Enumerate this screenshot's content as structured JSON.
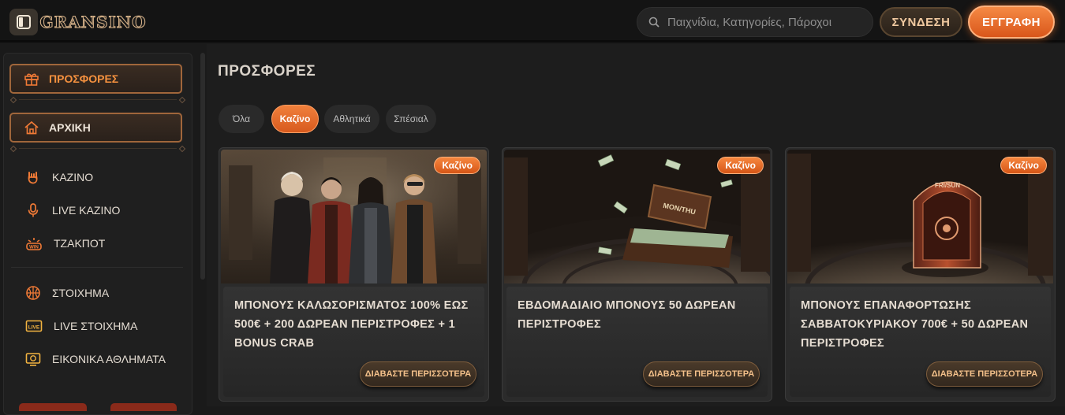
{
  "header": {
    "logo_text": "GRANSINO",
    "search_placeholder": "Παιχνίδια, Κατηγορίες, Πάροχοι",
    "login_label": "ΣΥΝΔΕΣΗ",
    "register_label": "ΕΓΓΡΑΦΗ"
  },
  "sidebar": {
    "promotions_label": "ΠΡΟΣΦΟΡΕΣ",
    "home_label": "ΑΡΧΙΚΗ",
    "casino_items": [
      {
        "label": "ΚΑΖΙΝΟ",
        "icon": "rock-hand-icon"
      },
      {
        "label": "LIVE ΚΑΖΙΝΟ",
        "icon": "microphone-icon"
      },
      {
        "label": "ΤΖΑΚΠΟΤ",
        "icon": "jackpot-win-icon"
      }
    ],
    "sports_items": [
      {
        "label": "ΣΤΟΙΧΗΜΑ",
        "icon": "basketball-icon"
      },
      {
        "label": "LIVE ΣΤΟΙΧΗΜΑ",
        "icon": "live-badge-icon"
      },
      {
        "label": "ΕΙΚΟΝΙΚΑ ΑΘΛΗΜΑΤΑ",
        "icon": "virtual-sports-icon"
      }
    ]
  },
  "main": {
    "title": "ΠΡΟΣΦΟΡΕΣ",
    "tabs": [
      {
        "label": "Όλα",
        "active": false
      },
      {
        "label": "Καζίνο",
        "active": true
      },
      {
        "label": "Αθλητικά",
        "active": false
      },
      {
        "label": "Σπέσιαλ",
        "active": false
      }
    ],
    "cards": [
      {
        "badge": "Καζίνο",
        "title": "ΜΠΟΝΟΥΣ ΚΑΛΩΣΟΡΙΣΜΑΤΟΣ 100% ΕΩΣ 500€ + 200 ΔΩΡΕΑΝ ΠΕΡΙΣΤΡΟΦΕΣ + 1 BONUS CRAB",
        "button": "ΔΙΑΒΑΣΤΕ ΠΕΡΙΣΣΟΤΕΡΑ",
        "image": "characters-group"
      },
      {
        "badge": "Καζίνο",
        "title": "ΕΒΔΟΜΑΔΙΑΙΟ ΜΠΟΝΟΥΣ 50 ΔΩΡΕΑΝ ΠΕΡΙΣΤΡΟΦΕΣ",
        "button": "ΔΙΑΒΑΣΤΕ ΠΕΡΙΣΣΟΤΕΡΑ",
        "image": "money-case",
        "case_label": "MON/THU"
      },
      {
        "badge": "Καζίνο",
        "title": "ΜΠΟΝΟΥΣ ΕΠΑΝΑΦΟΡΤΩΣΗΣ ΣΑΒΒΑΤΟΚΥΡΙΑΚΟΥ 700€ + 50 ΔΩΡΕΑΝ ΠΕΡΙΣΤΡΟΦΕΣ",
        "button": "ΔΙΑΒΑΣΤΕ ΠΕΡΙΣΣΟΤΕΡΑ",
        "image": "safe-box",
        "safe_label": "FRI/SUN"
      }
    ]
  },
  "colors": {
    "accent": "#e8692a",
    "gold": "#d9b48a",
    "background": "#1a1a1a"
  }
}
